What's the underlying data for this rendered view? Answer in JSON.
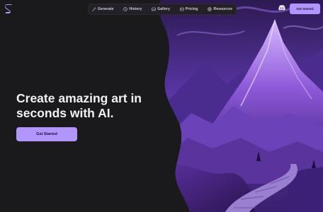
{
  "brand": {
    "logo": "s-logo-icon",
    "accent": "#b295ff"
  },
  "nav": {
    "items": [
      {
        "label": "Generate",
        "icon": "wand-icon"
      },
      {
        "label": "History",
        "icon": "clock-icon"
      },
      {
        "label": "Gallery",
        "icon": "gallery-icon"
      },
      {
        "label": "Pricing",
        "icon": "tag-icon"
      },
      {
        "label": "Resources",
        "icon": "globe-icon"
      }
    ]
  },
  "header": {
    "discord_icon": "discord-icon",
    "cta_label": "Get Started"
  },
  "hero": {
    "title_line1": "Create amazing art in",
    "title_line2": "seconds with AI.",
    "cta_label": "Get Started",
    "image": "purple-mountain-landscape"
  }
}
